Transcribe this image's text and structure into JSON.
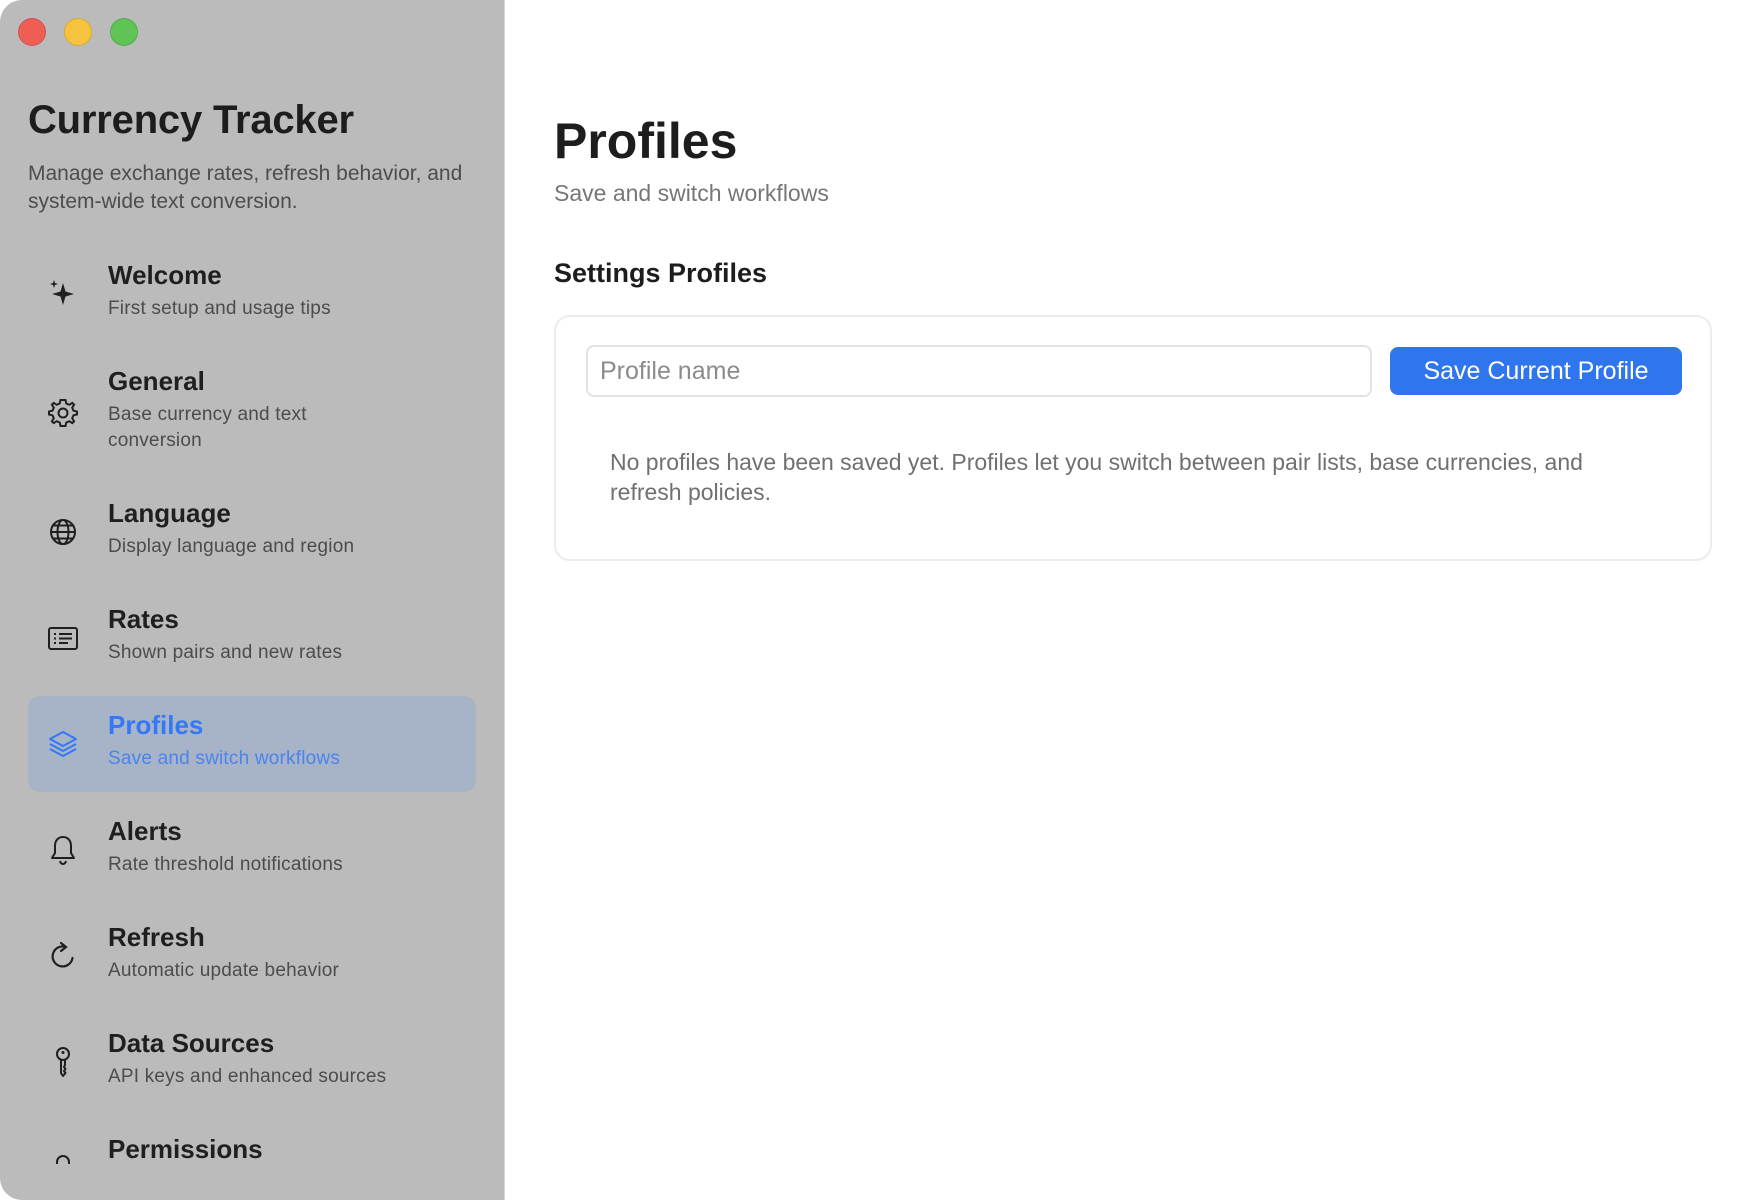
{
  "sidebar": {
    "app_title": "Currency Tracker",
    "app_subtitle": "Manage exchange rates, refresh behavior, and system-wide text conversion.",
    "items": [
      {
        "label": "Welcome",
        "description": "First setup and usage tips",
        "icon": "sparkle-icon"
      },
      {
        "label": "General",
        "description": "Base currency and text conversion",
        "icon": "gear-icon"
      },
      {
        "label": "Language",
        "description": "Display language and region",
        "icon": "globe-icon"
      },
      {
        "label": "Rates",
        "description": "Shown pairs and new rates",
        "icon": "list-card-icon"
      },
      {
        "label": "Profiles",
        "description": "Save and switch workflows",
        "icon": "layers-icon",
        "active": true
      },
      {
        "label": "Alerts",
        "description": "Rate threshold notifications",
        "icon": "bell-icon"
      },
      {
        "label": "Refresh",
        "description": "Automatic update behavior",
        "icon": "refresh-icon"
      },
      {
        "label": "Data Sources",
        "description": "API keys and enhanced sources",
        "icon": "key-icon"
      },
      {
        "label": "Permissions",
        "description": "",
        "icon": "lock-icon"
      }
    ]
  },
  "main": {
    "title": "Profiles",
    "subtitle": "Save and switch workflows",
    "section_title": "Settings Profiles",
    "profile_input": {
      "value": "",
      "placeholder": "Profile name"
    },
    "save_button": "Save Current Profile",
    "empty_message": "No profiles have been saved yet. Profiles let you switch between pair lists, base currencies, and refresh policies."
  },
  "colors": {
    "accent": "#2f76ee",
    "sidebar_bg": "#bbbbbb",
    "active_item_bg": "#a7b3c6"
  }
}
